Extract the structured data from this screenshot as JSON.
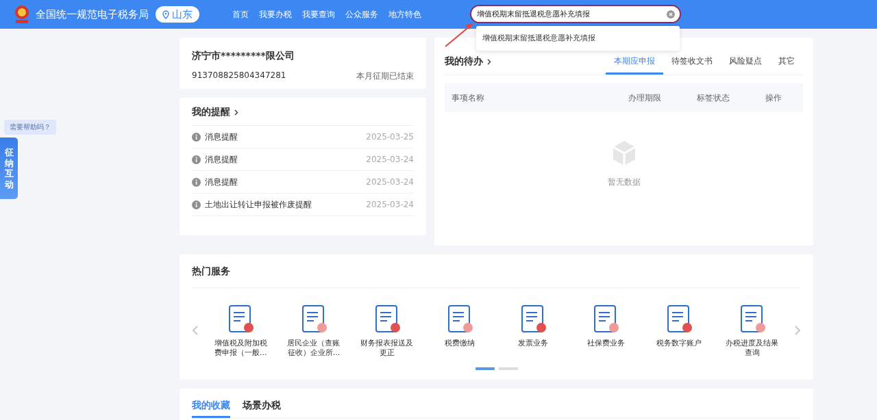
{
  "header": {
    "title": "全国统一规范电子税务局",
    "location": "山东",
    "nav": [
      "首页",
      "我要办税",
      "我要查询",
      "公众服务",
      "地方特色"
    ],
    "search": {
      "value": "增值税期末留抵退税意愿补充填报",
      "suggestions": [
        "增值税期末留抵退税意愿补充填报"
      ]
    }
  },
  "help": {
    "bubble": "需要帮助吗？",
    "tab": "征纳互动"
  },
  "company": {
    "name": "济宁市*********限公司",
    "tax_id": "913708825804347281",
    "status": "本月征期已结束"
  },
  "reminders": {
    "title": "我的提醒",
    "items": [
      {
        "text": "消息提醒",
        "date": "2025-03-25"
      },
      {
        "text": "消息提醒",
        "date": "2025-03-24"
      },
      {
        "text": "消息提醒",
        "date": "2025-03-24"
      },
      {
        "text": "土地出让转让申报被作废提醒",
        "date": "2025-03-24"
      }
    ]
  },
  "todo": {
    "title": "我的待办",
    "tabs": [
      {
        "label": "本期应申报",
        "selected": true
      },
      {
        "label": "待签收文书",
        "selected": false
      },
      {
        "label": "风险疑点",
        "selected": false
      },
      {
        "label": "其它",
        "selected": false
      }
    ],
    "columns": [
      "事项名称",
      "办理期限",
      "标签状态",
      "操作"
    ],
    "empty": "暂无数据"
  },
  "hot_services": {
    "title": "热门服务",
    "items": [
      "增值税及附加税费申报（一般...",
      "居民企业（查账征收）企业所...",
      "财务报表报送及更正",
      "税费缴纳",
      "发票业务",
      "社保费业务",
      "税务数字账户",
      "办税进度及结果查询"
    ],
    "pages": [
      {
        "selected": true
      },
      {
        "selected": false
      }
    ]
  },
  "favorites": {
    "tabs": [
      {
        "label": "我的收藏",
        "selected": true
      },
      {
        "label": "场景办税",
        "selected": false
      }
    ]
  }
}
